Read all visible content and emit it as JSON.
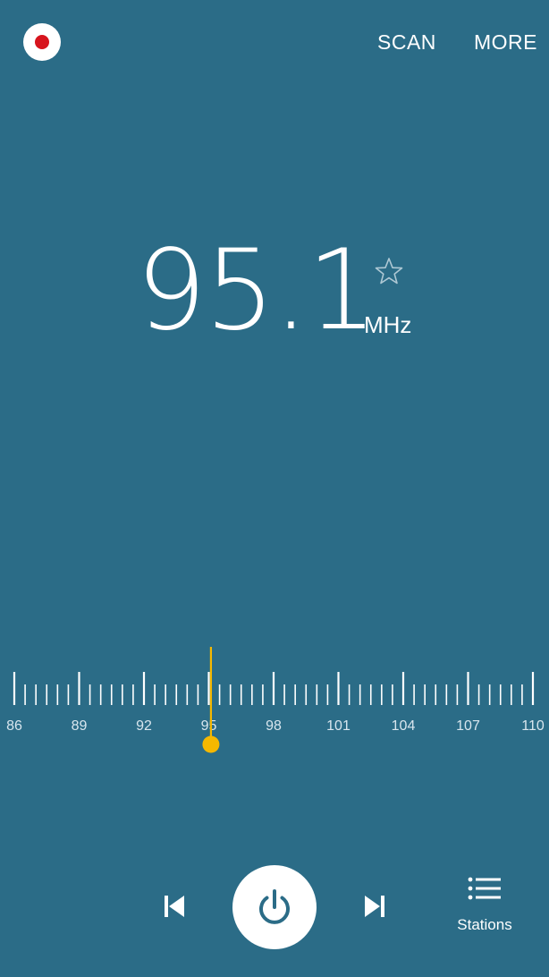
{
  "app": {
    "background": "#2b6c87",
    "accent": "#f5b800",
    "record_color": "#d7141d"
  },
  "toolbar": {
    "record_icon": "record-icon",
    "scan_label": "SCAN",
    "more_label": "MORE"
  },
  "tuner": {
    "frequency": "95.1",
    "unit": "MHz",
    "favorite_icon": "star-outline-icon",
    "is_favorite": false,
    "current_value": 95.1,
    "scale_min": 86,
    "scale_max": 110,
    "tick_labels": [
      "86",
      "89",
      "92",
      "95",
      "98",
      "101",
      "104",
      "107",
      "110"
    ]
  },
  "controls": {
    "prev_icon": "skip-previous-icon",
    "power_icon": "power-icon",
    "next_icon": "skip-next-icon",
    "stations_icon": "list-icon",
    "stations_label": "Stations"
  }
}
